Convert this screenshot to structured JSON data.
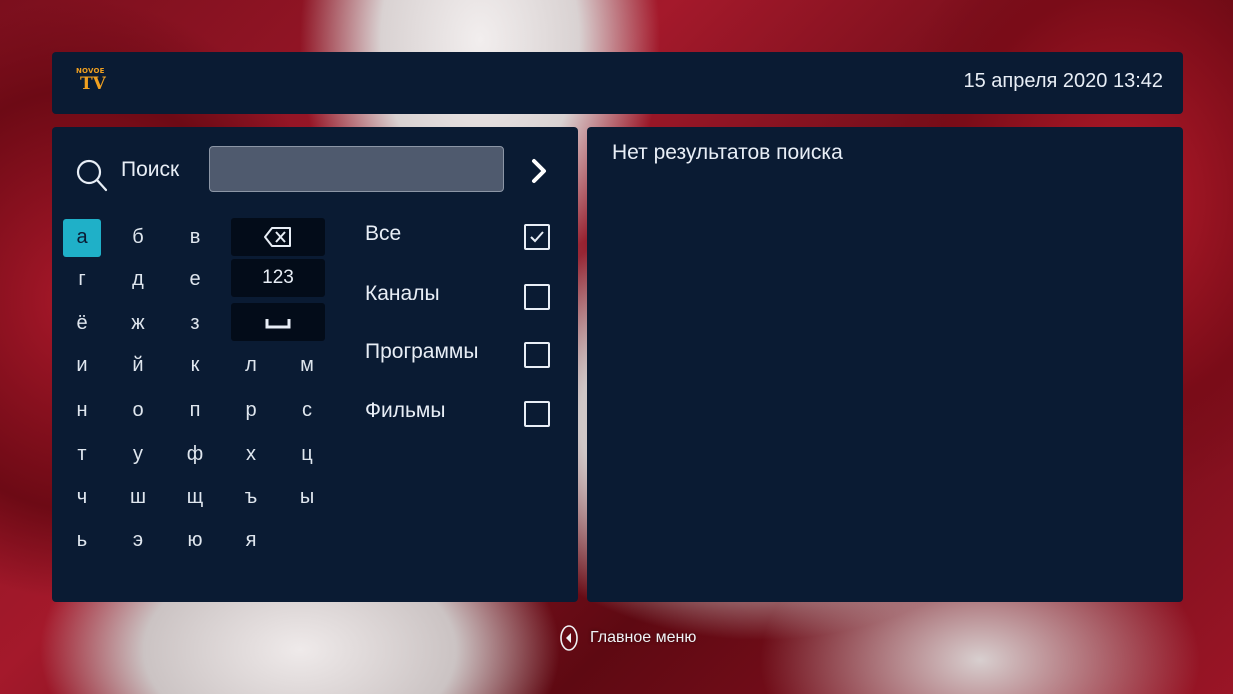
{
  "header": {
    "logo_small": "NOVOE",
    "logo_big": "TV",
    "datetime": "15 апреля 2020 13:42"
  },
  "search": {
    "label": "Поиск",
    "value": "",
    "placeholder": ""
  },
  "keyboard": {
    "rows": [
      [
        "а",
        "б",
        "в"
      ],
      [
        "г",
        "д",
        "е"
      ],
      [
        "ё",
        "ж",
        "з"
      ],
      [
        "и",
        "й",
        "к",
        "л",
        "м"
      ],
      [
        "н",
        "о",
        "п",
        "р",
        "с"
      ],
      [
        "т",
        "у",
        "ф",
        "х",
        "ц"
      ],
      [
        "ч",
        "ш",
        "щ",
        "ъ",
        "ы"
      ],
      [
        "ь",
        "э",
        "ю",
        "я"
      ]
    ],
    "numbers_label": "123",
    "active_key": "а"
  },
  "filters": [
    {
      "label": "Все",
      "checked": true
    },
    {
      "label": "Каналы",
      "checked": false
    },
    {
      "label": "Программы",
      "checked": false
    },
    {
      "label": "Фильмы",
      "checked": false
    }
  ],
  "results": {
    "empty_text": "Нет результатов поиска"
  },
  "footer": {
    "main_menu_label": "Главное меню"
  },
  "colors": {
    "panel": "#0a1b33",
    "accent": "#1fb0c8",
    "logo": "#f0a020"
  }
}
